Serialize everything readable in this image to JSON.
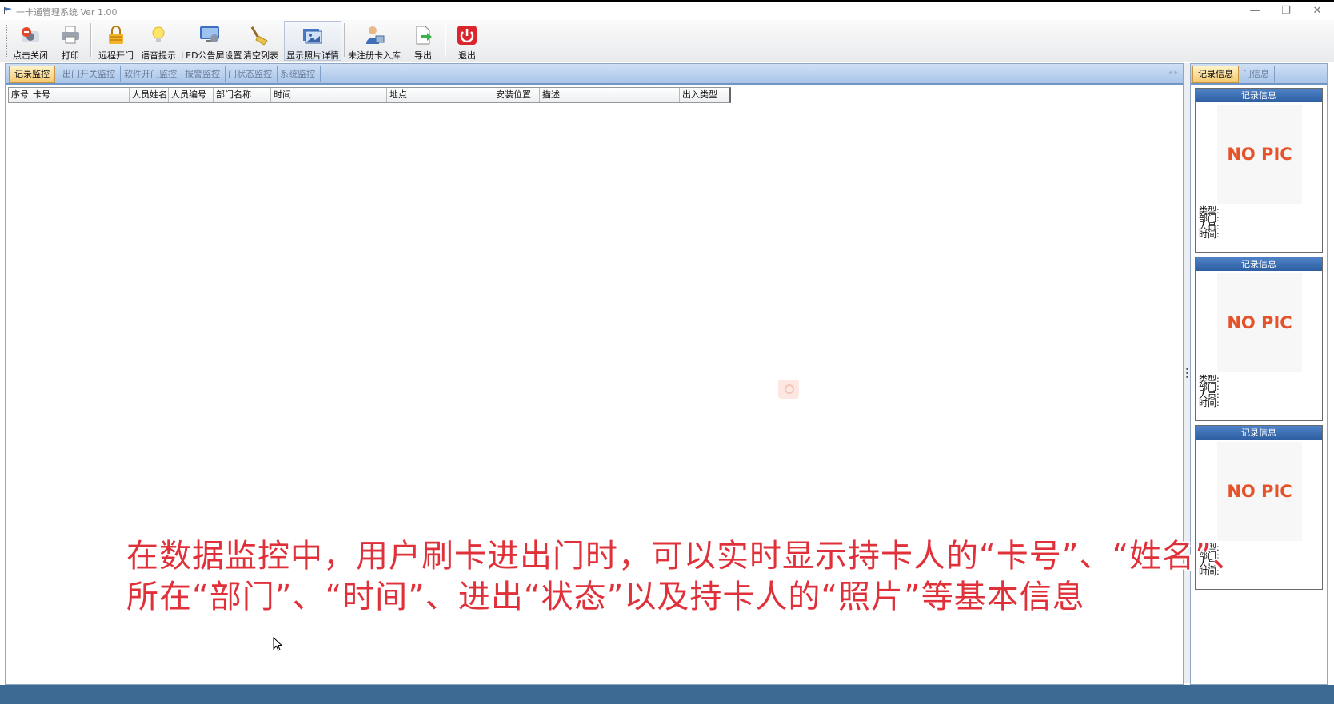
{
  "window": {
    "title": "一卡通管理系统  Ver 1.00",
    "min_glyph": "—",
    "max_glyph": "❐",
    "close_glyph": "✕"
  },
  "toolbar": {
    "items": [
      {
        "label": "点击关闭",
        "icon": "camera-close-icon"
      },
      {
        "label": "打印",
        "icon": "printer-icon"
      },
      {
        "label": "远程开门",
        "icon": "lock-icon"
      },
      {
        "label": "语音提示",
        "icon": "lightbulb-icon"
      },
      {
        "label": "LED公告屏设置",
        "icon": "monitor-settings-icon"
      },
      {
        "label": "清空列表",
        "icon": "broom-icon"
      },
      {
        "label": "显示照片详情",
        "icon": "photo-details-icon"
      },
      {
        "label": "未注册卡入库",
        "icon": "user-card-icon"
      },
      {
        "label": "导出",
        "icon": "export-icon"
      },
      {
        "label": "退出",
        "icon": "power-icon"
      }
    ]
  },
  "tabs": [
    "记录监控",
    "出门开关监控",
    "软件开门监控",
    "报警监控",
    "门状态监控",
    "系统监控"
  ],
  "tab_controls": "◂ ▸",
  "grid": {
    "columns": [
      "序号",
      "卡号",
      "人员姓名",
      "人员编号",
      "部门名称",
      "时间",
      "地点",
      "安装位置",
      "描述",
      "出入类型"
    ]
  },
  "right_tabs": [
    "记录信息",
    "门信息"
  ],
  "cards": [
    {
      "title": "记录信息",
      "pic_text": "NO PIC",
      "fields": [
        "类型:",
        "部门:",
        "人员:",
        "时间:"
      ]
    },
    {
      "title": "记录信息",
      "pic_text": "NO PIC",
      "fields": [
        "类型:",
        "部门:",
        "人员:",
        "时间:"
      ]
    },
    {
      "title": "记录信息",
      "pic_text": "NO PIC",
      "fields": [
        "类型:",
        "部门:",
        "人员:",
        "时间:"
      ]
    }
  ],
  "caption": {
    "line1": "在数据监控中，用户刷卡进出门时，可以实时显示持卡人的“卡号”、“姓名”、",
    "line2": "所在“部门”、“时间”、进出“状态”以及持卡人的“照片”等基本信息"
  },
  "colors": {
    "caption": "#e0313a",
    "card_header": "#3a6db4",
    "no_pic": "#e5532a",
    "statusbar": "#3c6a93"
  }
}
